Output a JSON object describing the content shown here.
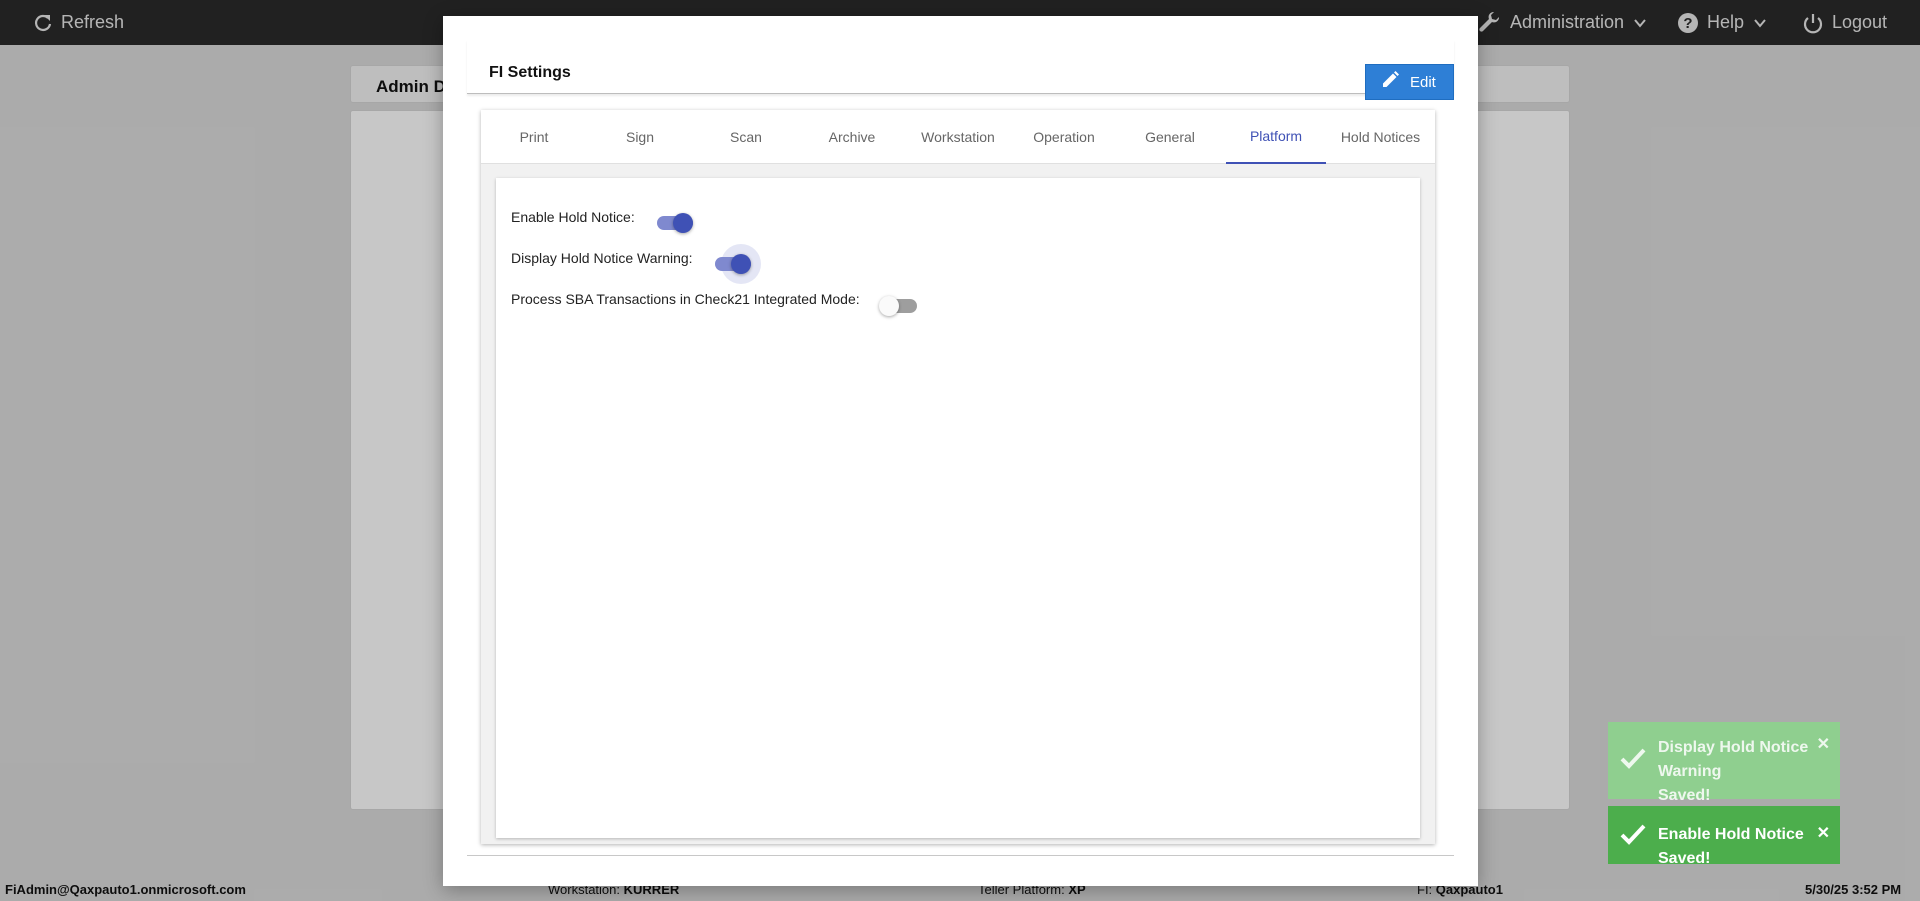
{
  "topbar": {
    "refresh_label": "Refresh",
    "administration_label": "Administration",
    "help_label": "Help",
    "logout_label": "Logout"
  },
  "background": {
    "admin_header": "Admin D"
  },
  "footer": {
    "user": "FiAdmin@Qaxpauto1.onmicrosoft.com",
    "workstation_label": "Workstation:",
    "workstation_value": "KURRER",
    "teller_label": "Teller Platform:",
    "teller_value": "XP",
    "fi_label": "FI:",
    "fi_value": "Qaxpauto1",
    "datetime": "5/30/25 3:52 PM"
  },
  "modal": {
    "title": "FI Settings",
    "edit_label": "Edit",
    "tabs": [
      {
        "label": "Print"
      },
      {
        "label": "Sign"
      },
      {
        "label": "Scan"
      },
      {
        "label": "Archive"
      },
      {
        "label": "Workstation"
      },
      {
        "label": "Operation"
      },
      {
        "label": "General"
      },
      {
        "label": "Platform"
      },
      {
        "label": "Hold Notices"
      }
    ],
    "active_tab": "Platform",
    "settings": [
      {
        "label": "Enable Hold Notice:",
        "enabled": true
      },
      {
        "label": "Display Hold Notice Warning:",
        "enabled": true
      },
      {
        "label": "Process SBA Transactions in Check21 Integrated Mode:",
        "enabled": false
      }
    ]
  },
  "toasts": [
    {
      "message_line1": "Display Hold Notice Warning",
      "message_line2": "Saved!",
      "color": "#8fcf8f"
    },
    {
      "message": "Enable Hold Notice Saved!",
      "color": "#4cae4c"
    }
  ],
  "colors": {
    "accent": "#3f51b5",
    "edit_button": "#2e7fd6",
    "topbar": "#2b2b2b"
  }
}
